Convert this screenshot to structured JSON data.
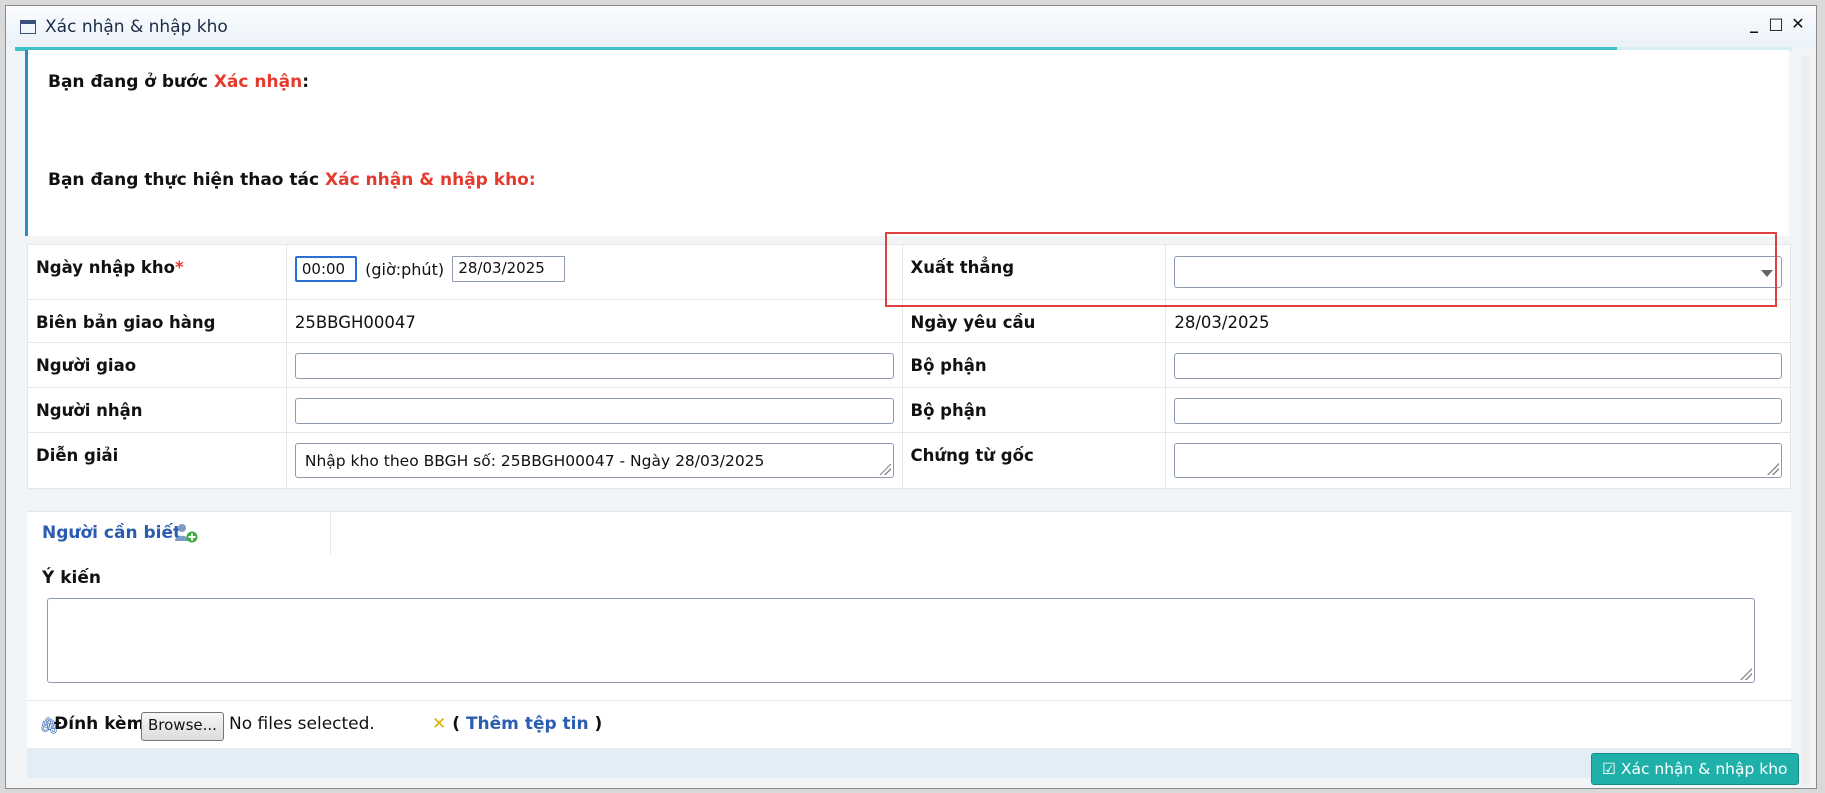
{
  "window": {
    "title": "Xác nhận & nhập kho"
  },
  "info": {
    "step_prefix": "Bạn đang ở bước ",
    "step_name": "Xác nhận",
    "step_suffix": ":",
    "action_prefix": "Bạn đang thực hiện thao tác ",
    "action_name": "Xác nhận & nhập kho:"
  },
  "form": {
    "ngay_nhap_kho": {
      "label": "Ngày nhập kho",
      "required": "*",
      "time": "00:00",
      "time_hint": "(giờ:phút)",
      "date": "28/03/2025"
    },
    "xuat_thang": {
      "label": "Xuất thẳng",
      "value": ""
    },
    "bien_ban": {
      "label": "Biên bản giao hàng",
      "value": "25BBGH00047"
    },
    "ngay_yeu_cau": {
      "label": "Ngày yêu cầu",
      "value": "28/03/2025"
    },
    "nguoi_giao": {
      "label": "Người giao",
      "value": ""
    },
    "bo_phan_1": {
      "label": "Bộ phận",
      "value": ""
    },
    "nguoi_nhan": {
      "label": "Người nhận",
      "value": ""
    },
    "bo_phan_2": {
      "label": "Bộ phận",
      "value": ""
    },
    "dien_giai": {
      "label": "Diễn giải",
      "value": "Nhập kho theo BBGH số: 25BBGH00047 - Ngày 28/03/2025"
    },
    "chung_tu_goc": {
      "label": "Chứng từ gốc",
      "value": ""
    }
  },
  "people": {
    "label": "Người cần biết"
  },
  "opinion": {
    "label": "Ý kiến",
    "value": ""
  },
  "attach": {
    "label": "Đính kèm",
    "browse_label": "Browse...",
    "status": "No files selected.",
    "open_paren": "( ",
    "add_label": "Thêm tệp tin",
    "close_paren": " )"
  },
  "actions": {
    "confirm_label": "Xác nhận & nhập kho"
  },
  "colors": {
    "accent": "#1fb1a9",
    "required": "#e53b2f",
    "link": "#2a5db0",
    "highlight": "#e04040"
  }
}
